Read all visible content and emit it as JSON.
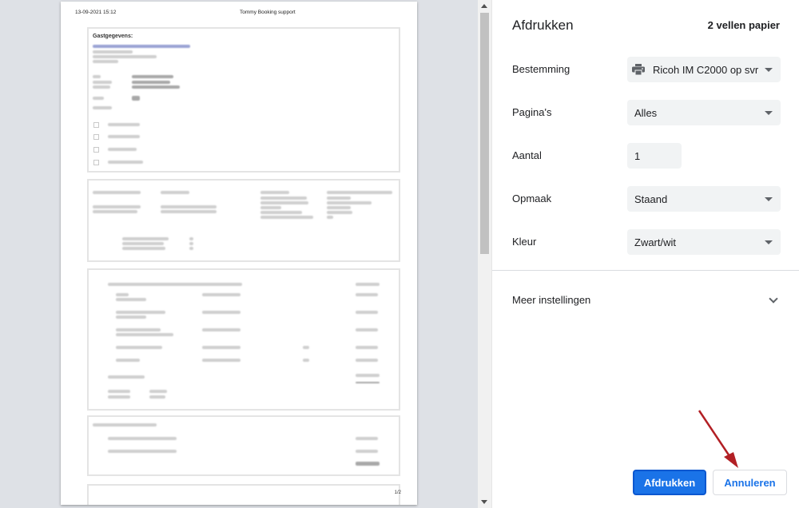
{
  "preview": {
    "header_date": "13-09-2021 15:12",
    "header_title": "Tommy Booking support",
    "guest_title": "Gastgegevens:",
    "page_number": "1/2"
  },
  "panel": {
    "title": "Afdrukken",
    "sheet_count": "2 vellen papier",
    "destination": {
      "label": "Bestemming",
      "value": "Ricoh IM C2000 op svr",
      "icon": "printer-icon"
    },
    "pages": {
      "label": "Pagina's",
      "value": "Alles"
    },
    "copies": {
      "label": "Aantal",
      "value": "1"
    },
    "layout": {
      "label": "Opmaak",
      "value": "Staand"
    },
    "color": {
      "label": "Kleur",
      "value": "Zwart/wit"
    },
    "more_settings": {
      "label": "Meer instellingen",
      "icon": "chevron-down-icon"
    },
    "print_button": "Afdrukken",
    "cancel_button": "Annuleren"
  },
  "colors": {
    "accent": "#1a73e8",
    "arrow": "#b21f24"
  }
}
